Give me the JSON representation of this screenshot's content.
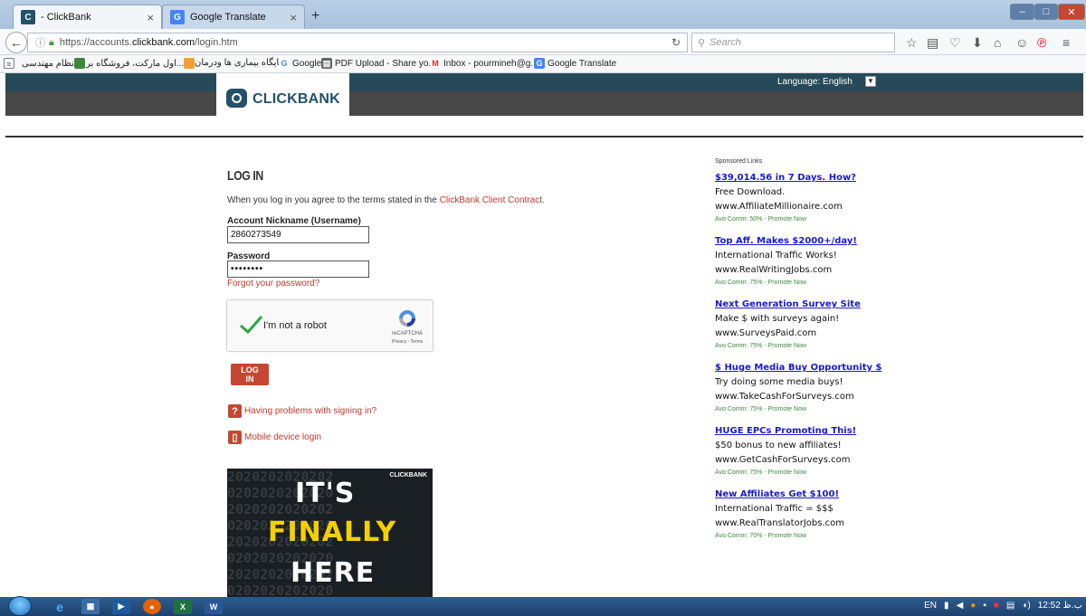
{
  "browser": {
    "tabs": [
      {
        "label": "- ClickBank",
        "active": true
      },
      {
        "label": "Google Translate",
        "active": false
      }
    ],
    "new_tab": "+",
    "url_prefix": "https://accounts.",
    "url_domain": "clickbank.com",
    "url_path": "/login.htm",
    "search_placeholder": "Search",
    "bookmarks": [
      {
        "label": "نظام مهندسی"
      },
      {
        "label": "...اول مارکت، فروشگاه بر"
      },
      {
        "label": "پایگاه بیماری ها ودرمان"
      },
      {
        "label": "Google"
      },
      {
        "label": "PDF Upload - Share yo..."
      },
      {
        "label": "Inbox - pourmineh@g..."
      },
      {
        "label": "Google Translate"
      }
    ]
  },
  "header": {
    "logo_text": "CLICKBANK",
    "language_label": "Language:  English"
  },
  "login": {
    "title": "LOG IN",
    "terms_prefix": "When you log in you agree to the terms stated in the ",
    "terms_link": "ClickBank Client Contract.",
    "username_label": "Account Nickname (Username)",
    "username_value": "2860273549",
    "password_label": "Password",
    "password_value": "••••••••",
    "forgot_link": "Forgot your password?",
    "captcha_label": "I'm not a robot",
    "captcha_brand": "reCAPTCHA",
    "captcha_terms": "Privacy - Terms",
    "button_label": "LOG IN",
    "help_link": "Having problems with signing in?",
    "mobile_link": "Mobile device login"
  },
  "promo": {
    "brand": "CLICKBANK",
    "line1": "IT'S",
    "line2": "FINALLY",
    "line3": "HERE",
    "background_text": "2020202020202\n0202020202020\n2020202020202\n0202020202020\n2020202020202\n0202020202020\n2020202020202\n0202020202020"
  },
  "sponsored": {
    "heading": "Sponsored Links",
    "ads": [
      {
        "title": "$39,014.56 in 7 Days. How?",
        "line": "Free Download.",
        "url": "www.AffiliateMillionaire.com",
        "comm": "Avg Comm: 50% - Promote Now"
      },
      {
        "title": "Top Aff. Makes $2000+/day!",
        "line": "International Traffic Works!",
        "url": "www.RealWritingJobs.com",
        "comm": "Avg Comm: 75% - Promote Now"
      },
      {
        "title": "Next Generation Survey Site",
        "line": "Make $ with surveys again!",
        "url": "www.SurveysPaid.com",
        "comm": "Avg Comm: 75% - Promote Now"
      },
      {
        "title": "$ Huge Media Buy Opportunity $",
        "line": "Try doing some media buys!",
        "url": "www.TakeCashForSurveys.com",
        "comm": "Avg Comm: 75% - Promote Now"
      },
      {
        "title": "HUGE EPCs Promoting This!",
        "line": "$50 bonus to new affiliates!",
        "url": "www.GetCashForSurveys.com",
        "comm": "Avg Comm: 75% - Promote Now"
      },
      {
        "title": "New Affiliates Get $100!",
        "line": "International Traffic = $$$",
        "url": "www.RealTranslatorJobs.com",
        "comm": "Avg Comm: 70% - Promote Now"
      }
    ]
  },
  "taskbar": {
    "lang": "EN",
    "clock": "12:52 ب.ظ"
  },
  "colors": {
    "header_top": "#264a5a",
    "header_bottom": "#474747",
    "accent_red": "#c54732",
    "ad_link": "#1a1acc"
  }
}
